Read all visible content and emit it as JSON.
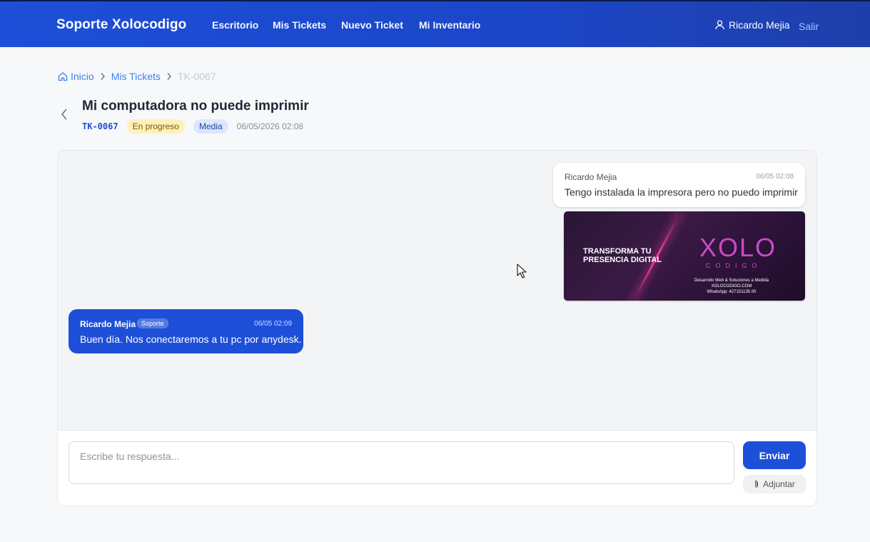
{
  "app": {
    "brand": "Soporte Xolocodigo"
  },
  "nav": {
    "items": [
      "Escritorio",
      "Mis Tickets",
      "Nuevo Ticket",
      "Mi Inventario"
    ]
  },
  "user": {
    "name": "Ricardo Mejia",
    "logout": "Salir"
  },
  "breadcrumb": {
    "home": "Inicio",
    "section": "Mis Tickets",
    "current": "TK-0067"
  },
  "ticket": {
    "title": "Mi computadora no puede imprimir",
    "code": "TK-0067",
    "status": "En progreso",
    "priority": "Media",
    "date": "06/05/2026 02:08",
    "status_color": "#fdf1b7",
    "priority_color": "#dbe7fb"
  },
  "messages": [
    {
      "author": "Ricardo Mejia",
      "time": "06/05 02:08",
      "text": "Tengo instalada la impresora pero no puedo imprimir"
    },
    {
      "author": "Ricardo Mejia",
      "role": "Soporte",
      "time": "06/05 02:09",
      "text": "Buen día. Nos conectaremos a tu pc por anydesk."
    }
  ],
  "attachment": {
    "headline_1": "TRANSFORMA TU",
    "headline_2": "PRESENCIA DIGITAL",
    "logo": "XOLO",
    "logo_sub": "CODIGO",
    "footer_1": "Desarrollo Web & Soluciones a Medida",
    "footer_2": "XOLOCODIGO.COM",
    "footer_3": "WhatsApp: 427151135 00"
  },
  "composer": {
    "placeholder": "Escribe tu respuesta...",
    "send": "Enviar",
    "attach": "Adjuntar"
  },
  "colors": {
    "primary": "#1d4fd8",
    "background": "#f7f8fa"
  }
}
